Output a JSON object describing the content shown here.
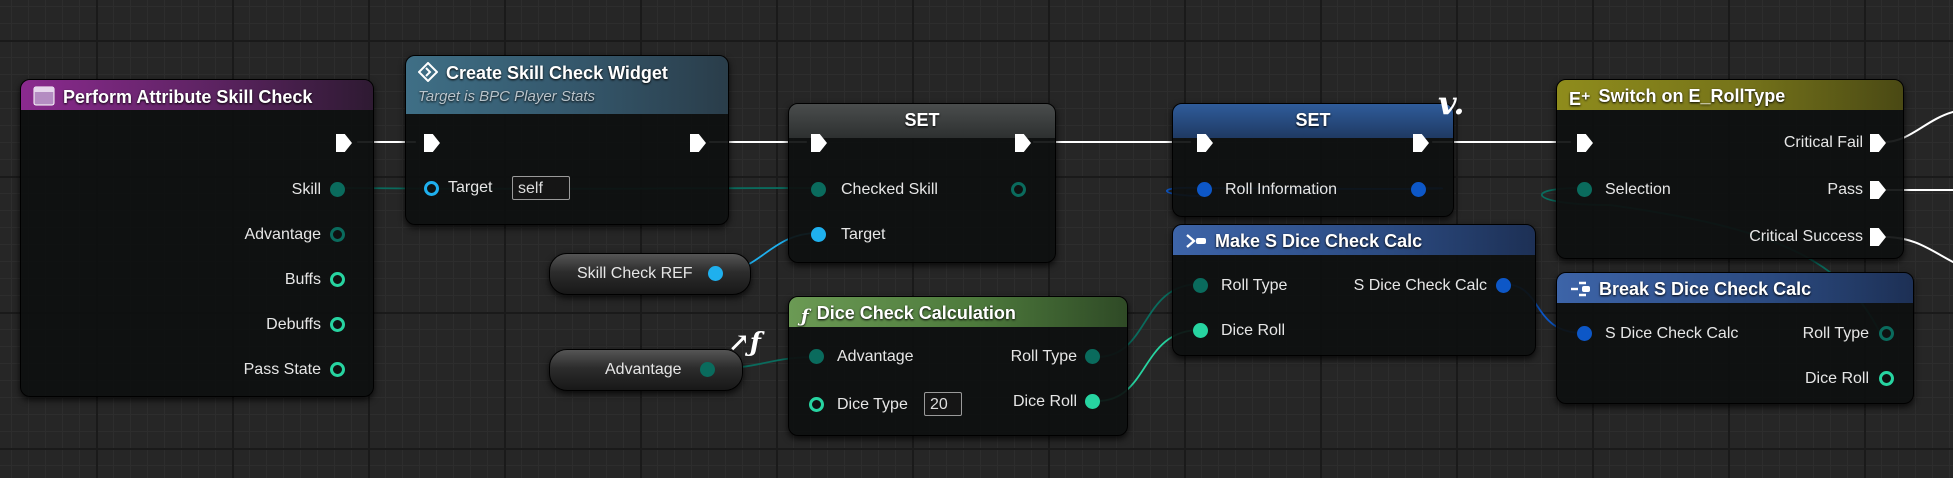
{
  "colors": {
    "exec": "#ffffff",
    "byte": "#0a6b5d",
    "struct": "#0d57c7",
    "object": "#1fb0ee",
    "integer": "#27d4a1",
    "wire_exec": "#ffffff"
  },
  "nodes": {
    "perform": {
      "title": "Perform Attribute Skill Check",
      "icon": "function-entry-icon",
      "outputs": [
        "Skill",
        "Advantage",
        "Buffs",
        "Debuffs",
        "Pass State"
      ]
    },
    "create_widget": {
      "title": "Create Skill Check Widget",
      "subtitle": "Target is BPC Player Stats",
      "target_label": "Target",
      "target_value": "self"
    },
    "set1": {
      "title": "SET",
      "input_label": "Checked Skill",
      "target_label": "Target"
    },
    "set2": {
      "title": "SET",
      "input_label": "Roll Information"
    },
    "skill_ref": {
      "label": "Skill Check REF"
    },
    "advantage_var": {
      "label": "Advantage"
    },
    "dice_calc": {
      "title": "Dice Check Calculation",
      "inputs": [
        "Advantage",
        "Dice Type"
      ],
      "dice_type_value": "20",
      "outputs": [
        "Roll Type",
        "Dice Roll"
      ]
    },
    "make_struct": {
      "title": "Make S Dice Check Calc",
      "inputs": [
        "Roll Type",
        "Dice Roll"
      ],
      "output": "S Dice Check Calc"
    },
    "switch": {
      "title": "Switch on E_RollType",
      "input": "Selection",
      "outputs": [
        "Critical Fail",
        "Pass",
        "Critical Success"
      ]
    },
    "break_struct": {
      "title": "Break S Dice Check Calc",
      "input": "S Dice Check Calc",
      "outputs": [
        "Roll Type",
        "Dice Roll"
      ]
    }
  }
}
